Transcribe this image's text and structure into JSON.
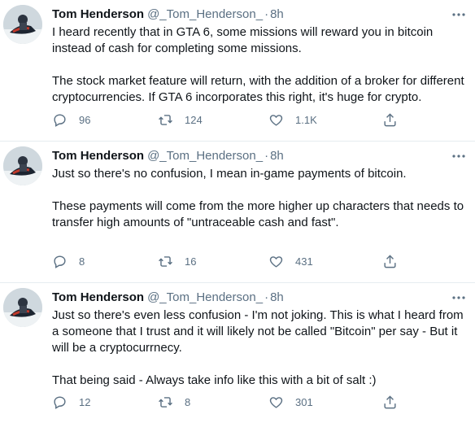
{
  "tweets": [
    {
      "name": "Tom Henderson",
      "handle": "@_Tom_Henderson_",
      "dot": "·",
      "time": "8h",
      "paragraphs": [
        "I heard recently that in GTA 6, some missions will reward you in bitcoin instead of cash for completing some missions.",
        "The stock market feature will return, with the addition of a broker for different cryptocurrencies. If GTA 6 incorporates this right, it's huge for crypto."
      ],
      "replies": "96",
      "retweets": "124",
      "likes": "1.1K"
    },
    {
      "name": "Tom Henderson",
      "handle": "@_Tom_Henderson_",
      "dot": "·",
      "time": "8h",
      "paragraphs": [
        "Just so there's no confusion, I mean in-game payments of bitcoin.",
        "These payments will come from the more higher up characters that needs to transfer high amounts of \"untraceable cash and fast\"."
      ],
      "replies": "8",
      "retweets": "16",
      "likes": "431"
    },
    {
      "name": "Tom Henderson",
      "handle": "@_Tom_Henderson_",
      "dot": "·",
      "time": "8h",
      "paragraphs": [
        "Just so there's even less confusion - I'm not joking. This is what I heard from a someone that I trust and it will likely not be called \"Bitcoin\" per say - But it will be a cryptocurrnecy.",
        "That being said - Always take info like this with a bit of salt :)"
      ],
      "replies": "12",
      "retweets": "8",
      "likes": "301"
    }
  ],
  "icons": {
    "more": "more-horizontal-icon",
    "reply": "reply-icon",
    "retweet": "retweet-icon",
    "like": "heart-icon",
    "share": "share-icon"
  },
  "colors": {
    "text": "#0f1419",
    "secondary": "#5b7083",
    "divider": "#e6ecf0"
  }
}
